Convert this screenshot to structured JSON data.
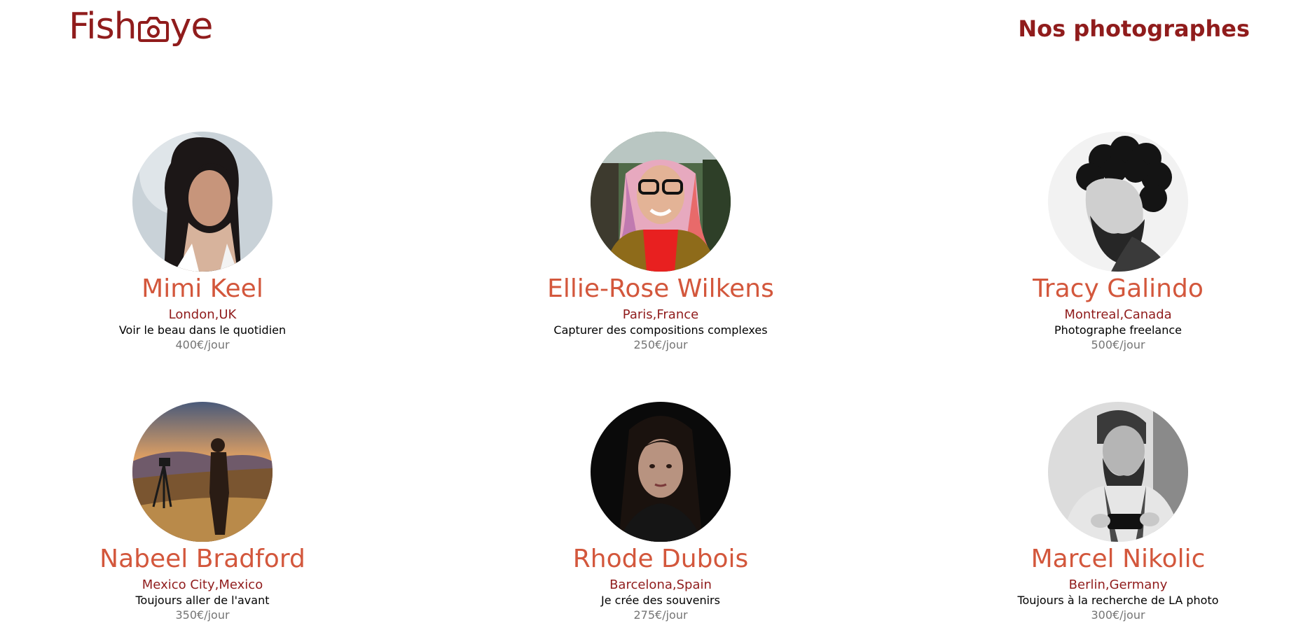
{
  "header": {
    "logo_left": "Fish",
    "logo_right": "ye",
    "logo_icon": "camera-icon",
    "title": "Nos photographes"
  },
  "colors": {
    "brand": "#901C1C",
    "name": "#D3573C",
    "price": "#757575"
  },
  "photographers": [
    {
      "name": "Mimi Keel",
      "location": "London,UK",
      "tagline": "Voir le beau dans le quotidien",
      "price": "400€/jour"
    },
    {
      "name": "Ellie-Rose Wilkens",
      "location": "Paris,France",
      "tagline": "Capturer des compositions complexes",
      "price": "250€/jour"
    },
    {
      "name": "Tracy Galindo",
      "location": "Montreal,Canada",
      "tagline": "Photographe freelance",
      "price": "500€/jour"
    },
    {
      "name": "Nabeel Bradford",
      "location": "Mexico City,Mexico",
      "tagline": "Toujours aller de l'avant",
      "price": "350€/jour"
    },
    {
      "name": "Rhode Dubois",
      "location": "Barcelona,Spain",
      "tagline": "Je crée des souvenirs",
      "price": "275€/jour"
    },
    {
      "name": "Marcel Nikolic",
      "location": "Berlin,Germany",
      "tagline": "Toujours à la recherche de LA photo",
      "price": "300€/jour"
    }
  ]
}
